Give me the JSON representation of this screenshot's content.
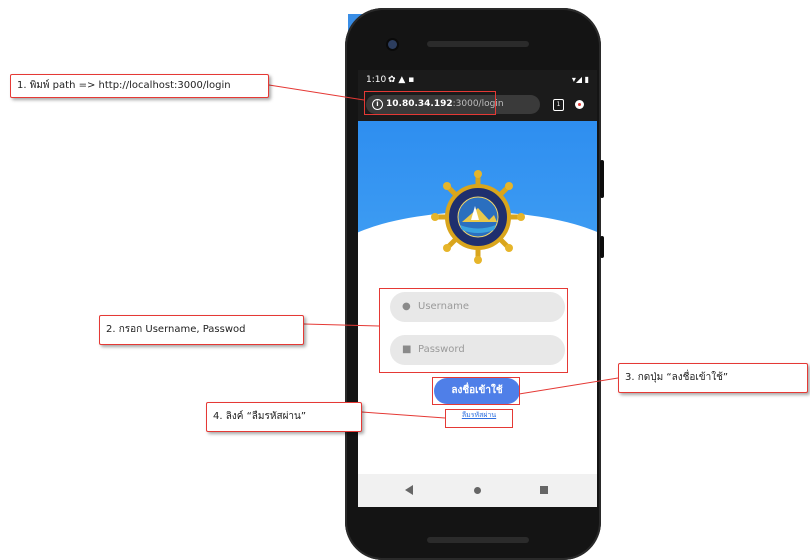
{
  "callouts": {
    "step1": "1. พิมพ์ path => http://localhost:3000/login",
    "step2": "2. กรอก Username, Passwod",
    "step3": "3. กดปุ่ม “ลงชื่อเข้าใช้”",
    "step4": "4. ลิงค์ “ลืมรหัสผ่าน”"
  },
  "phone": {
    "status_time": "1:10",
    "status_icons": "✿ ▲ ▪",
    "status_right": "▾◢ ▮",
    "url_host": "10.80.34.192",
    "url_path": ":3000/login",
    "info_glyph": "i",
    "tab_count": "1"
  },
  "login": {
    "username_placeholder": "Username",
    "password_placeholder": "Password",
    "login_button": "ลงชื่อเข้าใช้",
    "forgot_link": "ลืมรหัสผ่าน"
  },
  "colors": {
    "hero": "#3d9cf3",
    "button": "#4f7fe8",
    "annotation": "#e53935"
  }
}
